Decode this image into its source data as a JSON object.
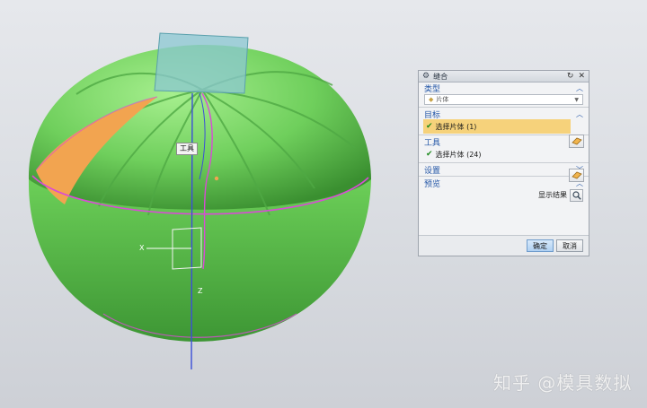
{
  "viewport": {
    "tooltip_text": "工具",
    "axis_z": "Z",
    "axis_x": "X",
    "colors": {
      "body": "#6fcf5c",
      "highlight_face": "#f2a450",
      "edge": "#d94bd6",
      "sheet": "#8bc7d2",
      "axis": "#3b4fd8"
    }
  },
  "dialog": {
    "title": "缝合",
    "sections": {
      "type": {
        "heading": "类型",
        "select_value": "片体"
      },
      "target": {
        "heading": "目标",
        "row_label": "选择片体 (1)"
      },
      "tool": {
        "heading": "工具",
        "row_label": "选择片体 (24)"
      },
      "settings": {
        "heading": "设置"
      },
      "preview": {
        "heading": "预览",
        "show_result": "显示结果"
      }
    },
    "buttons": {
      "ok": "确定",
      "cancel": "取消"
    }
  },
  "watermark": "知乎 @模具数拟"
}
